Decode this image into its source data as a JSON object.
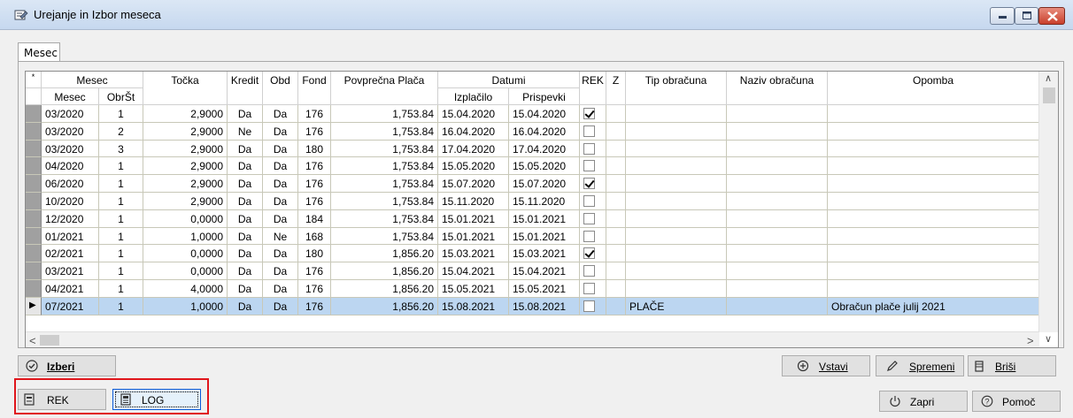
{
  "window": {
    "title": "Urejanje in Izbor meseca"
  },
  "tabs": [
    {
      "label": "Mesec"
    }
  ],
  "grid": {
    "corner": "*",
    "group_headers": {
      "mesec": "Mesec",
      "tocka": "Točka",
      "kredit": "Kredit",
      "obd": "Obd",
      "fond": "Fond",
      "povp": "Povprečna Plača",
      "datumi": "Datumi",
      "rek": "REK",
      "z": "Z",
      "tip": "Tip obračuna",
      "naziv": "Naziv obračuna",
      "opomba": "Opomba"
    },
    "sub_headers": {
      "mesec": "Mesec",
      "obrst": "ObrŠt",
      "izplacilo": "Izplačilo",
      "prispevki": "Prispevki"
    },
    "rows": [
      {
        "mesec": "03/2020",
        "obrst": "1",
        "tocka": "2,9000",
        "kredit": "Da",
        "obd": "Da",
        "fond": "176",
        "povp": "1,753.84",
        "izplacilo": "15.04.2020",
        "prispevki": "15.04.2020",
        "rek": true,
        "tip": "",
        "naziv": "",
        "opomba": ""
      },
      {
        "mesec": "03/2020",
        "obrst": "2",
        "tocka": "2,9000",
        "kredit": "Ne",
        "obd": "Da",
        "fond": "176",
        "povp": "1,753.84",
        "izplacilo": "16.04.2020",
        "prispevki": "16.04.2020",
        "rek": false,
        "tip": "",
        "naziv": "",
        "opomba": ""
      },
      {
        "mesec": "03/2020",
        "obrst": "3",
        "tocka": "2,9000",
        "kredit": "Da",
        "obd": "Da",
        "fond": "180",
        "povp": "1,753.84",
        "izplacilo": "17.04.2020",
        "prispevki": "17.04.2020",
        "rek": false,
        "tip": "",
        "naziv": "",
        "opomba": ""
      },
      {
        "mesec": "04/2020",
        "obrst": "1",
        "tocka": "2,9000",
        "kredit": "Da",
        "obd": "Da",
        "fond": "176",
        "povp": "1,753.84",
        "izplacilo": "15.05.2020",
        "prispevki": "15.05.2020",
        "rek": false,
        "tip": "",
        "naziv": "",
        "opomba": ""
      },
      {
        "mesec": "06/2020",
        "obrst": "1",
        "tocka": "2,9000",
        "kredit": "Da",
        "obd": "Da",
        "fond": "176",
        "povp": "1,753.84",
        "izplacilo": "15.07.2020",
        "prispevki": "15.07.2020",
        "rek": true,
        "tip": "",
        "naziv": "",
        "opomba": ""
      },
      {
        "mesec": "10/2020",
        "obrst": "1",
        "tocka": "2,9000",
        "kredit": "Da",
        "obd": "Da",
        "fond": "176",
        "povp": "1,753.84",
        "izplacilo": "15.11.2020",
        "prispevki": "15.11.2020",
        "rek": false,
        "tip": "",
        "naziv": "",
        "opomba": ""
      },
      {
        "mesec": "12/2020",
        "obrst": "1",
        "tocka": "0,0000",
        "kredit": "Da",
        "obd": "Da",
        "fond": "184",
        "povp": "1,753.84",
        "izplacilo": "15.01.2021",
        "prispevki": "15.01.2021",
        "rek": false,
        "tip": "",
        "naziv": "",
        "opomba": ""
      },
      {
        "mesec": "01/2021",
        "obrst": "1",
        "tocka": "1,0000",
        "kredit": "Da",
        "obd": "Ne",
        "fond": "168",
        "povp": "1,753.84",
        "izplacilo": "15.01.2021",
        "prispevki": "15.01.2021",
        "rek": false,
        "tip": "",
        "naziv": "",
        "opomba": ""
      },
      {
        "mesec": "02/2021",
        "obrst": "1",
        "tocka": "0,0000",
        "kredit": "Da",
        "obd": "Da",
        "fond": "180",
        "povp": "1,856.20",
        "izplacilo": "15.03.2021",
        "prispevki": "15.03.2021",
        "rek": true,
        "tip": "",
        "naziv": "",
        "opomba": ""
      },
      {
        "mesec": "03/2021",
        "obrst": "1",
        "tocka": "0,0000",
        "kredit": "Da",
        "obd": "Da",
        "fond": "176",
        "povp": "1,856.20",
        "izplacilo": "15.04.2021",
        "prispevki": "15.04.2021",
        "rek": false,
        "tip": "",
        "naziv": "",
        "opomba": ""
      },
      {
        "mesec": "04/2021",
        "obrst": "1",
        "tocka": "4,0000",
        "kredit": "Da",
        "obd": "Da",
        "fond": "176",
        "povp": "1,856.20",
        "izplacilo": "15.05.2021",
        "prispevki": "15.05.2021",
        "rek": false,
        "tip": "",
        "naziv": "",
        "opomba": ""
      },
      {
        "mesec": "07/2021",
        "obrst": "1",
        "tocka": "1,0000",
        "kredit": "Da",
        "obd": "Da",
        "fond": "176",
        "povp": "1,856.20",
        "izplacilo": "15.08.2021",
        "prispevki": "15.08.2021",
        "rek": false,
        "tip": "PLAČE",
        "naziv": "",
        "opomba": "Obračun plače julij 2021",
        "selected": true
      }
    ]
  },
  "buttons": {
    "izberi": "Izberi",
    "vstavi": "Vstavi",
    "spremeni": "Spremeni",
    "brisi": "Briši",
    "rek": "REK",
    "log": "LOG",
    "zapri": "Zapri",
    "pomoc": "Pomoč"
  },
  "icons": {
    "title": "edit-form-icon",
    "izberi": "check-circle-icon",
    "vstavi": "plus-circle-icon",
    "spremeni": "pencil-icon",
    "brisi": "trash-icon",
    "rek": "report-icon",
    "log": "log-icon",
    "zapri": "power-icon",
    "pomoc": "help-icon"
  },
  "colors": {
    "selection": "#bcd6f1",
    "highlight_border": "#e0161c",
    "close_button": "#c9402c"
  }
}
